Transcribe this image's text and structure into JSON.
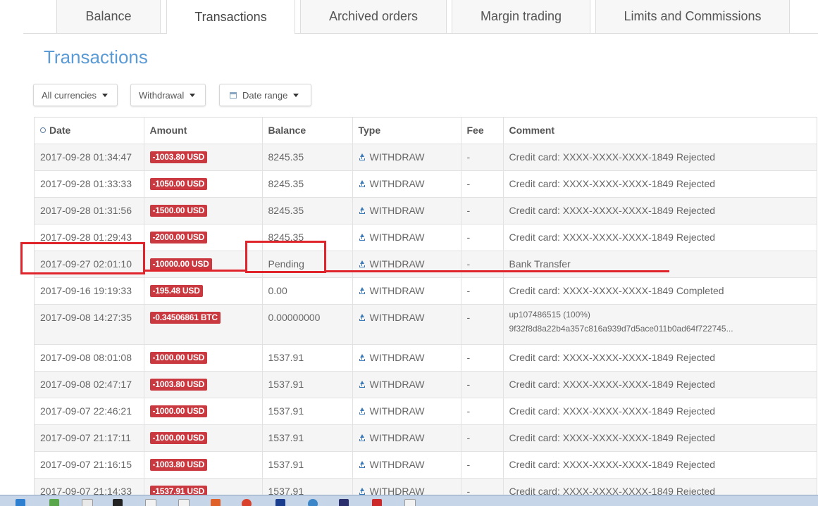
{
  "tabs": [
    {
      "label": "Balance",
      "active": false
    },
    {
      "label": "Transactions",
      "active": true
    },
    {
      "label": "Archived orders",
      "active": false
    },
    {
      "label": "Margin trading",
      "active": false
    },
    {
      "label": "Limits and Commissions",
      "active": false
    }
  ],
  "page_title": "Transactions",
  "filters": {
    "currency": "All currencies",
    "type": "Withdrawal",
    "date_range": "Date range"
  },
  "table": {
    "headers": [
      "Date",
      "Amount",
      "Balance",
      "Type",
      "Fee",
      "Comment"
    ],
    "rows": [
      {
        "date": "2017-09-28 01:34:47",
        "amount": "-1003.80 USD",
        "balance": "8245.35",
        "type": "WITHDRAW",
        "fee": "-",
        "comment": "Credit card: XXXX-XXXX-XXXX-1849 Rejected"
      },
      {
        "date": "2017-09-28 01:33:33",
        "amount": "-1050.00 USD",
        "balance": "8245.35",
        "type": "WITHDRAW",
        "fee": "-",
        "comment": "Credit card: XXXX-XXXX-XXXX-1849 Rejected"
      },
      {
        "date": "2017-09-28 01:31:56",
        "amount": "-1500.00 USD",
        "balance": "8245.35",
        "type": "WITHDRAW",
        "fee": "-",
        "comment": "Credit card: XXXX-XXXX-XXXX-1849 Rejected"
      },
      {
        "date": "2017-09-28 01:29:43",
        "amount": "-2000.00 USD",
        "balance": "8245.35",
        "type": "WITHDRAW",
        "fee": "-",
        "comment": "Credit card: XXXX-XXXX-XXXX-1849 Rejected"
      },
      {
        "date": "2017-09-27 02:01:10",
        "amount": "-10000.00 USD",
        "balance": "Pending",
        "type": "WITHDRAW",
        "fee": "-",
        "comment": "Bank Transfer"
      },
      {
        "date": "2017-09-16 19:19:33",
        "amount": "-195.48 USD",
        "balance": "0.00",
        "type": "WITHDRAW",
        "fee": "-",
        "comment": "Credit card: XXXX-XXXX-XXXX-1849 Completed"
      },
      {
        "date": "2017-09-08 14:27:35",
        "amount": "-0.34506861 BTC",
        "balance": "0.00000000",
        "type": "WITHDRAW",
        "fee": "-",
        "comment": "up107486515 (100%)",
        "comment_line2": "9f32f8d8a22b4a357c816a939d7d5ace011b0ad64f722745..."
      },
      {
        "date": "2017-09-08 08:01:08",
        "amount": "-1000.00 USD",
        "balance": "1537.91",
        "type": "WITHDRAW",
        "fee": "-",
        "comment": "Credit card: XXXX-XXXX-XXXX-1849 Rejected"
      },
      {
        "date": "2017-09-08 02:47:17",
        "amount": "-1003.80 USD",
        "balance": "1537.91",
        "type": "WITHDRAW",
        "fee": "-",
        "comment": "Credit card: XXXX-XXXX-XXXX-1849 Rejected"
      },
      {
        "date": "2017-09-07 22:46:21",
        "amount": "-1000.00 USD",
        "balance": "1537.91",
        "type": "WITHDRAW",
        "fee": "-",
        "comment": "Credit card: XXXX-XXXX-XXXX-1849 Rejected"
      },
      {
        "date": "2017-09-07 21:17:11",
        "amount": "-1000.00 USD",
        "balance": "1537.91",
        "type": "WITHDRAW",
        "fee": "-",
        "comment": "Credit card: XXXX-XXXX-XXXX-1849 Rejected"
      },
      {
        "date": "2017-09-07 21:16:15",
        "amount": "-1003.80 USD",
        "balance": "1537.91",
        "type": "WITHDRAW",
        "fee": "-",
        "comment": "Credit card: XXXX-XXXX-XXXX-1849 Rejected"
      },
      {
        "date": "2017-09-07 21:14:33",
        "amount": "-1537.91 USD",
        "balance": "1537.91",
        "type": "WITHDRAW",
        "fee": "-",
        "comment": "Credit card: XXXX-XXXX-XXXX-1849 Rejected"
      }
    ]
  },
  "colors": {
    "title": "#5b9bd5",
    "amount_badge": "#c9393f",
    "annotation": "#e0242b",
    "icon": "#3d7ab8"
  },
  "icons": {
    "sort": "clock-sort-icon",
    "type": "upload-icon",
    "date_filter": "calendar-icon",
    "dropdown": "caret-down-icon"
  }
}
